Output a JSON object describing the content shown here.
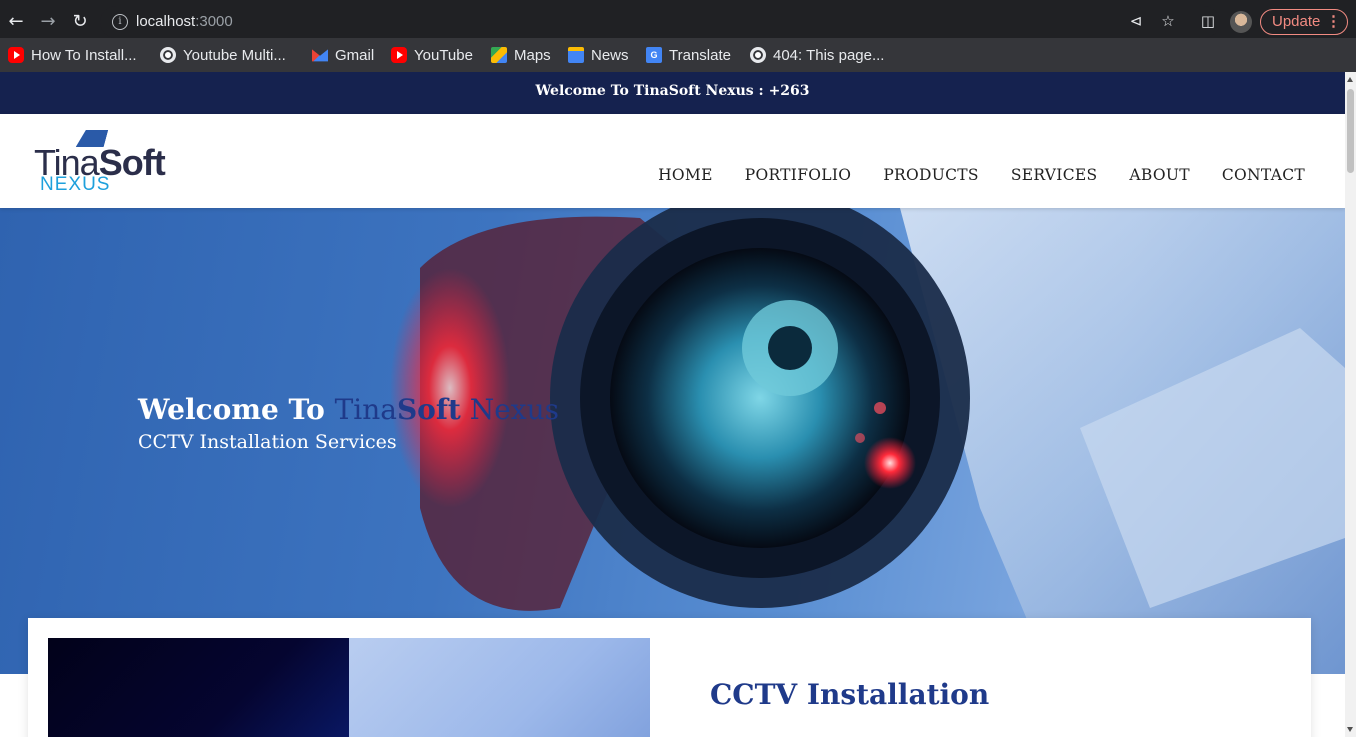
{
  "browser": {
    "url_host": "localhost",
    "url_port": ":3000",
    "update_label": "Update",
    "bookmarks": [
      {
        "label": "How To Install...",
        "icon": "youtube-icon"
      },
      {
        "label": "Youtube Multi...",
        "icon": "globe-icon"
      },
      {
        "label": "Gmail",
        "icon": "gmail-icon"
      },
      {
        "label": "YouTube",
        "icon": "youtube-icon"
      },
      {
        "label": "Maps",
        "icon": "maps-icon"
      },
      {
        "label": "News",
        "icon": "news-icon"
      },
      {
        "label": "Translate",
        "icon": "translate-icon"
      },
      {
        "label": "404: This page...",
        "icon": "globe-icon"
      }
    ]
  },
  "page": {
    "topbar_text": "Welcome To TinaSoft Nexus : +263",
    "logo": {
      "part1": "Tina",
      "part2": "Soft",
      "sub": "NEXUS"
    },
    "nav": [
      "HOME",
      "PORTIFOLIO",
      "PRODUCTS",
      "SERVICES",
      "ABOUT",
      "CONTACT"
    ],
    "hero": {
      "title_prefix": "Welcome To ",
      "brand_part1": "Tina",
      "brand_part2": "Soft",
      "brand_part3": " Nexus",
      "subtitle": "CCTV Installation Services"
    },
    "card": {
      "title": "CCTV Installation"
    },
    "colors": {
      "topbar": "#15224f",
      "brand_blue": "#1f3a8a",
      "logo_cyan": "#1ea0dc"
    }
  }
}
